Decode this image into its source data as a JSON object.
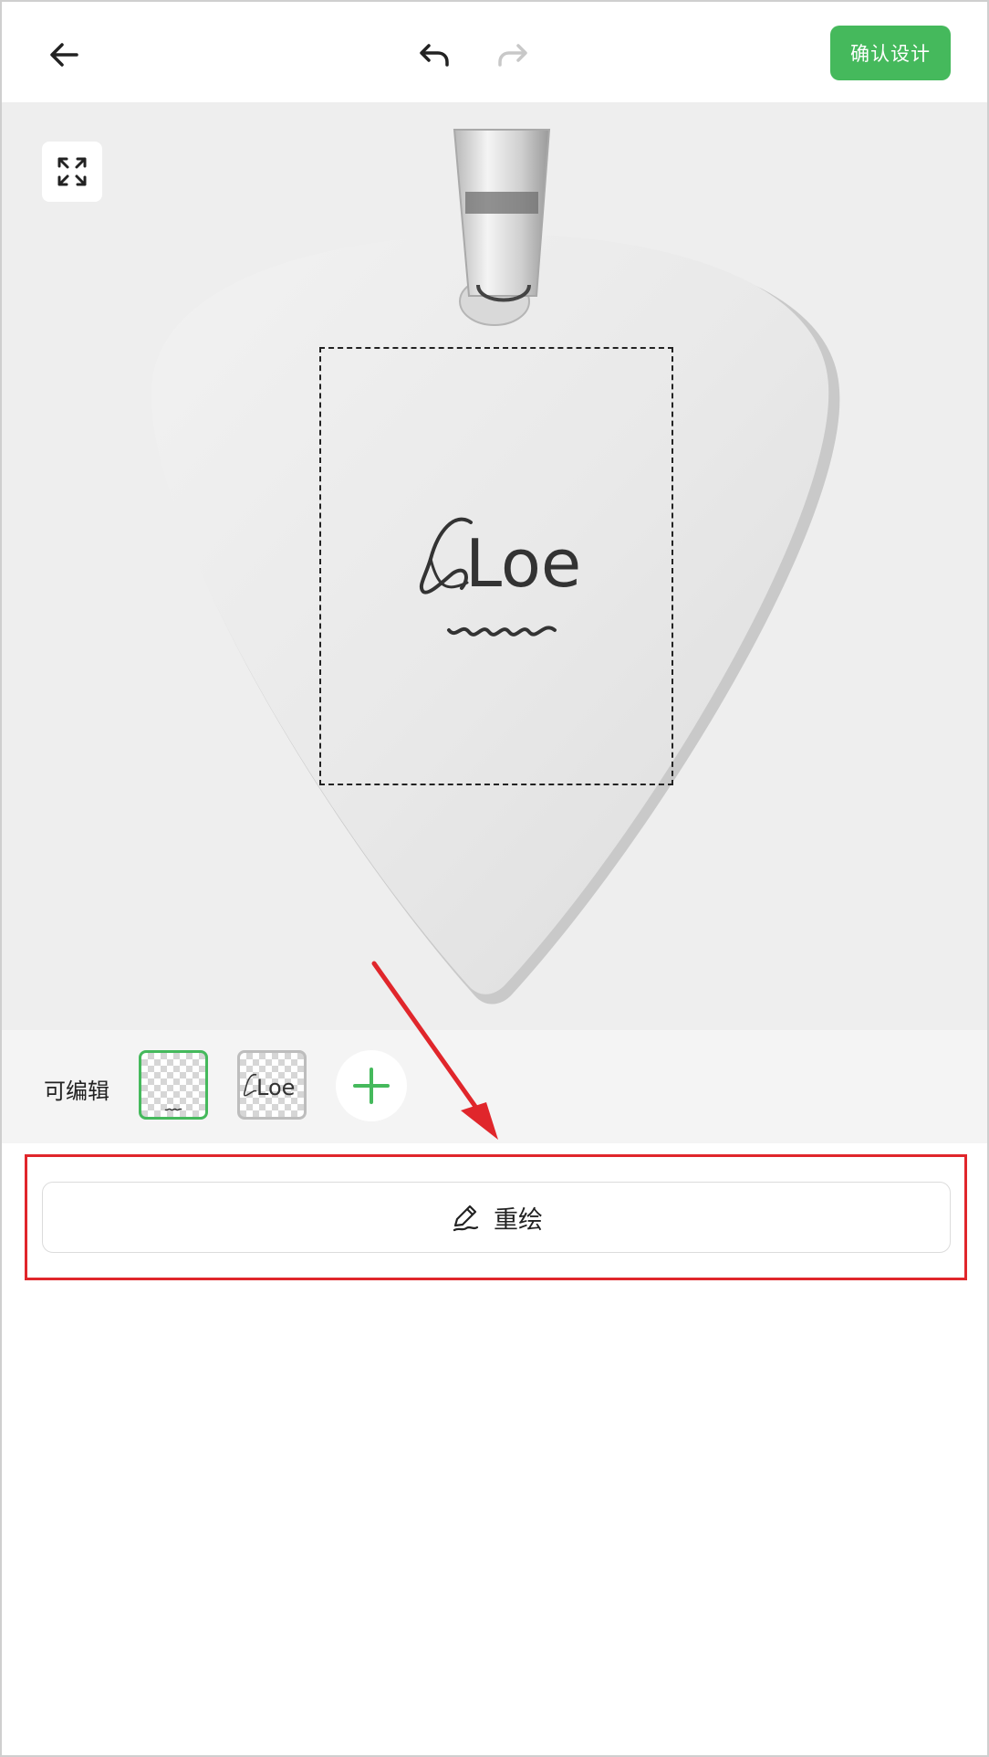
{
  "topbar": {
    "back_icon": "arrow-left-icon",
    "undo_icon": "undo-icon",
    "redo_icon": "redo-icon",
    "confirm_label": "确认设计"
  },
  "canvas": {
    "expand_icon": "expand-icon",
    "product": "guitar-pick-pendant",
    "design_text": "Loe"
  },
  "layers": {
    "label": "可编辑",
    "items": [
      {
        "name": "squiggle-layer",
        "selected": true
      },
      {
        "name": "text-layer",
        "text": "Loe",
        "selected": false
      }
    ],
    "add_icon": "plus-icon"
  },
  "redraw": {
    "icon": "pencil-icon",
    "label": "重绘"
  },
  "colors": {
    "accent": "#45b95c",
    "annotation": "#e0262b"
  }
}
